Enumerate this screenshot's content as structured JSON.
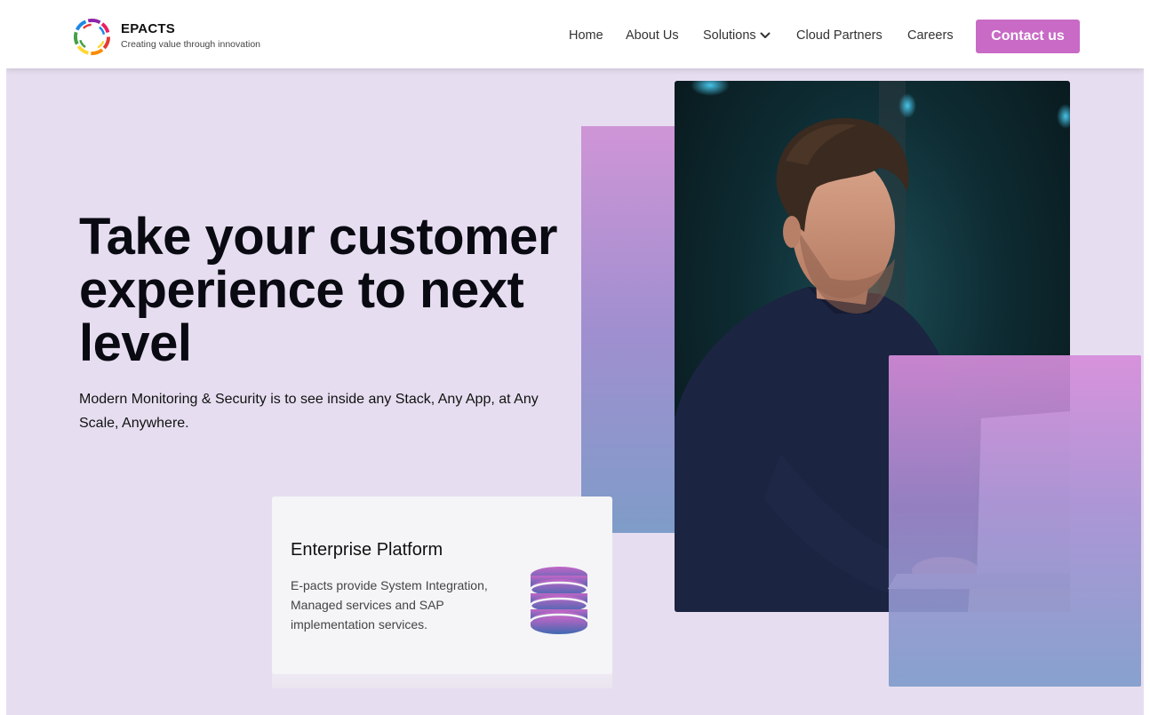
{
  "brand": {
    "name": "EPACTS",
    "tagline": "Creating value through innovation"
  },
  "nav": {
    "items": [
      {
        "label": "Home"
      },
      {
        "label": "About Us"
      },
      {
        "label": "Solutions"
      },
      {
        "label": "Cloud Partners"
      },
      {
        "label": "Careers"
      }
    ],
    "contact_label": "Contact us"
  },
  "hero": {
    "heading": "Take your customer experience to next level",
    "subheading": "Modern Monitoring & Security is to see inside any Stack, Any App, at Any Scale, Anywhere."
  },
  "card": {
    "title": "Enterprise Platform",
    "text": "E-pacts provide System Integration, Managed services and SAP implementation services.",
    "icon": "database-icon"
  },
  "colors": {
    "accent": "#c86ac6",
    "background": "#e6def0",
    "gradient_top": "#cf95d6",
    "gradient_bottom": "#7f9cc8"
  }
}
